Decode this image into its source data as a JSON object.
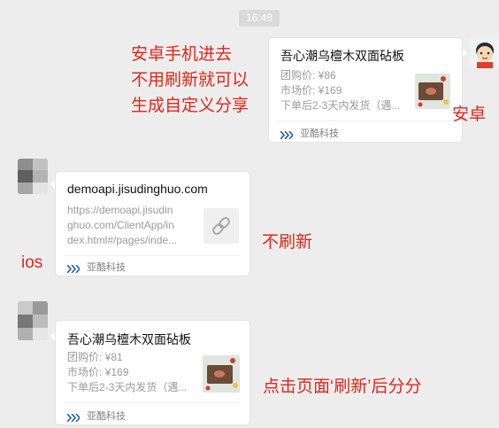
{
  "timestamp": "16:48",
  "annotations": {
    "android_note": [
      "安卓手机进去",
      "不用刷新就可以",
      "生成自定义分享"
    ],
    "android_label": "安卓",
    "no_refresh_label": "不刷新",
    "ios_label": "ios",
    "refresh_note": "点击页面‘刷新’后分分"
  },
  "messages": [
    {
      "side": "right",
      "title": "吾心潮乌檀木双面砧板",
      "lines": [
        "团购价: ¥86",
        "市场价: ¥169",
        "下单后2-3天内发货（遇..."
      ],
      "footer": "亚酷科技"
    },
    {
      "side": "left",
      "title": "demoapi.jisudinghuo.com",
      "lines": [
        "https://demoapi.jisudin",
        "ghuo.com/ClientApp/in",
        "dex.html#/pages/inde..."
      ],
      "footer": "亚酷科技",
      "thumb_icon": "link-icon"
    },
    {
      "side": "left",
      "title": "吾心潮乌檀木双面砧板",
      "lines": [
        "团购价: ¥81",
        "市场价: ¥169",
        "下单后2-3天内发货（遇..."
      ],
      "footer": "亚酷科技"
    }
  ],
  "colors": {
    "annotation_red": "#e0261b",
    "background": "#ededed",
    "bubble": "#ffffff",
    "timestamp_bg": "#dadada"
  }
}
